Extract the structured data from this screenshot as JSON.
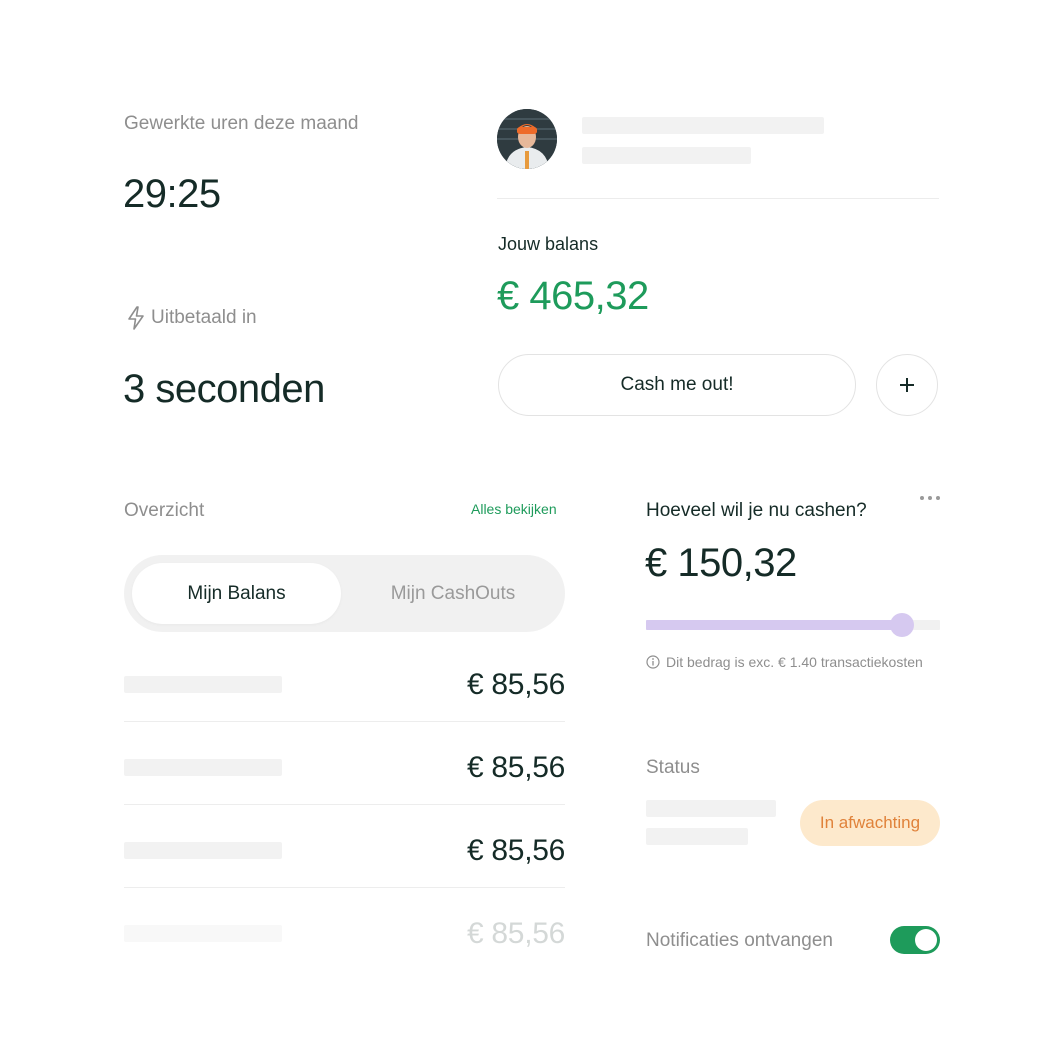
{
  "hours": {
    "label": "Gewerkte uren deze maand",
    "value": "29:25"
  },
  "payout": {
    "label": "Uitbetaald in",
    "value": "3 seconden",
    "icon": "lightning-icon"
  },
  "profile": {
    "avatar_icon": "avatar-photo"
  },
  "balance": {
    "label": "Jouw balans",
    "value": "€ 465,32",
    "cashout_label": "Cash me out!",
    "add_icon": "plus-icon",
    "accent": "#1e9b5b"
  },
  "overview": {
    "title": "Overzicht",
    "view_all": "Alles bekijken",
    "tabs": [
      {
        "label": "Mijn Balans",
        "active": true
      },
      {
        "label": "Mijn CashOuts",
        "active": false
      }
    ],
    "rows": [
      {
        "amount": "€ 85,56"
      },
      {
        "amount": "€ 85,56"
      },
      {
        "amount": "€ 85,56"
      },
      {
        "amount": "€ 85,56"
      }
    ]
  },
  "cashout": {
    "question": "Hoeveel wil je nu cashen?",
    "amount": "€ 150,32",
    "slider_fraction": 0.87,
    "note": "Dit bedrag is exc. € 1.40 transactiekosten",
    "more_icon": "more-dots-icon",
    "info_icon": "info-icon"
  },
  "status": {
    "title": "Status",
    "badge": "In afwachting",
    "badge_bg": "#fde9cc",
    "badge_color": "#e0823a"
  },
  "notifications": {
    "label": "Notificaties ontvangen",
    "enabled": true
  }
}
